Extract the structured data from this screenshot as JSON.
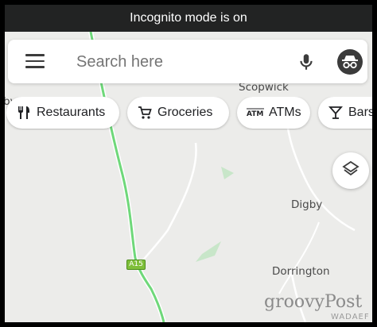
{
  "status_bar": {
    "text": "Incognito mode is on"
  },
  "search": {
    "placeholder": "Search here"
  },
  "chips": [
    {
      "label": "Restaurants",
      "icon": "fork-knife-icon"
    },
    {
      "label": "Groceries",
      "icon": "shopping-cart-icon"
    },
    {
      "label": "ATMs",
      "icon": "atm-icon"
    },
    {
      "label": "Bars",
      "icon": "cocktail-icon"
    }
  ],
  "map": {
    "places": [
      "Scopwick",
      "Digby",
      "Dorrington"
    ],
    "edge_label": "by",
    "road_shield": "A15",
    "road_color": "#6fd87a",
    "land_color": "#ececea",
    "park_color": "#c8e6c9"
  },
  "watermark": {
    "main": "groovyPost",
    "sub": "WADAEF"
  }
}
